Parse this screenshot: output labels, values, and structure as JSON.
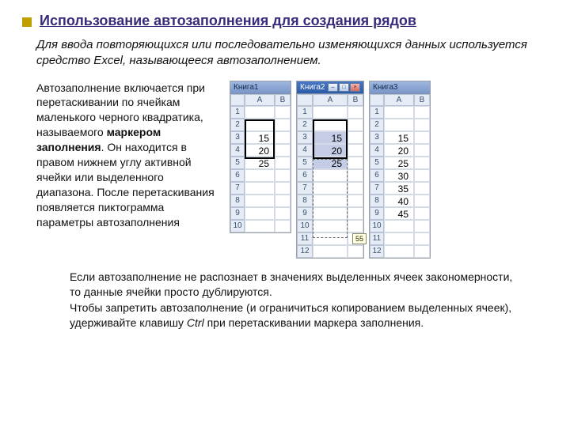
{
  "title": "Использование автозаполнения для создания рядов",
  "subtitle": "Для ввода повторяющихся или последовательно изменяющихся данных используется средство Excel, называющееся автозаполнением.",
  "paragraph": {
    "p1": "Автозаполнение включается при перетаскивании по ячейкам маленького черного квадратика, называемого ",
    "bold1": "маркером заполнения",
    "p2": ". Он находится в правом нижнем углу активной ячейки или выделенного диапазона. После перетаскивания появляется пиктограмма параметры автозаполнения"
  },
  "sheets": {
    "s1": {
      "title": "Книга1",
      "cols": [
        "A",
        "B"
      ],
      "rows": [
        "1",
        "2",
        "3",
        "4",
        "5",
        "6",
        "7",
        "8",
        "9",
        "10"
      ],
      "valuesA": [
        "",
        "",
        "15",
        "20",
        "25",
        "",
        "",
        "",
        "",
        ""
      ]
    },
    "s2": {
      "title": "Книга2",
      "cols": [
        "A",
        "B"
      ],
      "rows": [
        "1",
        "2",
        "3",
        "4",
        "5",
        "6",
        "7",
        "8",
        "9",
        "10",
        "11",
        "12"
      ],
      "valuesA": [
        "",
        "",
        "15",
        "20",
        "25",
        "",
        "",
        "",
        "",
        "",
        "",
        ""
      ],
      "tooltip": "55"
    },
    "s3": {
      "title": "Книга3",
      "cols": [
        "A",
        "B"
      ],
      "rows": [
        "1",
        "2",
        "3",
        "4",
        "5",
        "6",
        "7",
        "8",
        "9",
        "10",
        "11",
        "12"
      ],
      "valuesA": [
        "",
        "",
        "15",
        "20",
        "25",
        "30",
        "35",
        "40",
        "45",
        "",
        "",
        ""
      ]
    }
  },
  "bottom": {
    "l1": "Если автозаполнение не распознает в значениях выделенных ячеек закономерности, то данные ячейки просто дублируются.",
    "l2a": "Чтобы запретить автозаполнение (и ограничиться копированием выделенных ячеек), удерживайте клавишу ",
    "l2b": "Ctrl",
    "l2c": " при перетаскивании маркера заполнения."
  }
}
